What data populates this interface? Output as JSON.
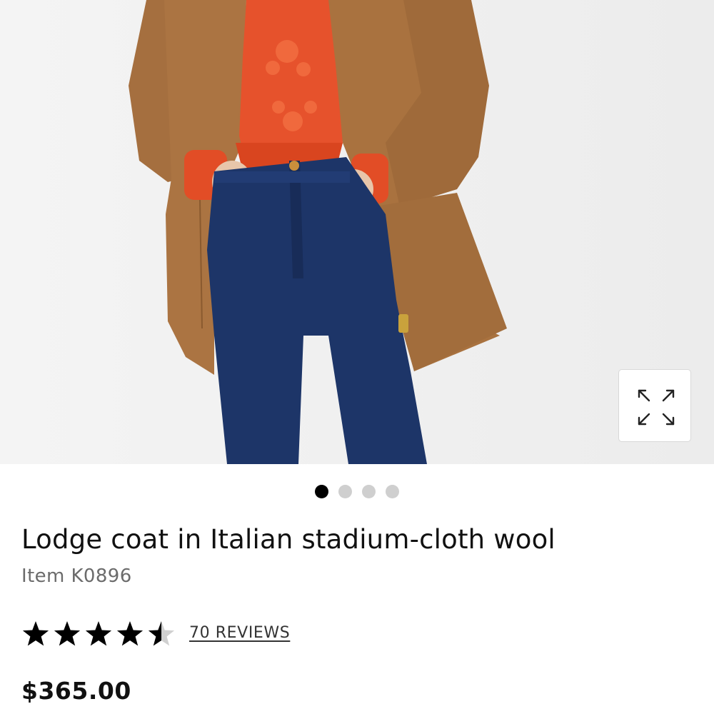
{
  "product": {
    "title": "Lodge coat in Italian stadium-cloth wool",
    "item_number": "Item K0896",
    "price": "$365.00",
    "rating": 4.5,
    "rating_max": 5,
    "reviews_label": "70 REVIEWS"
  },
  "gallery": {
    "image_count": 4,
    "active_index": 0,
    "expand_icon": "expand-arrows-icon"
  },
  "colors": {
    "coat": "#a8713e",
    "sweater": "#e6522c",
    "jeans": "#1d3568",
    "star": "#000000",
    "dot_active": "#000000",
    "dot_inactive": "#cfcfcf"
  }
}
